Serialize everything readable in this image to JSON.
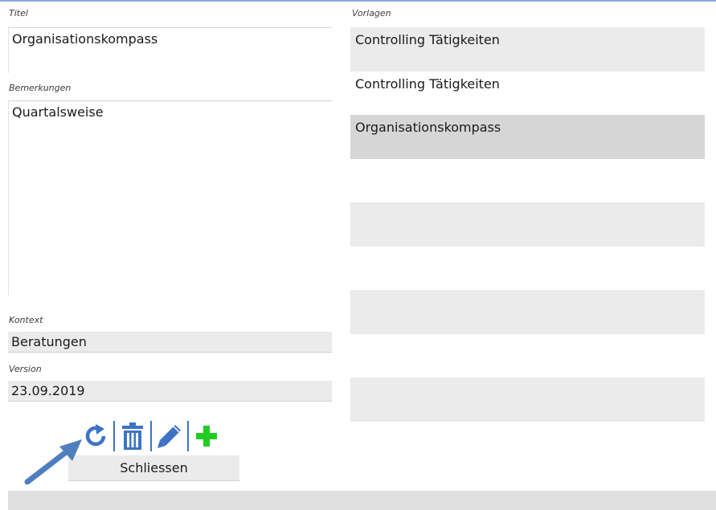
{
  "labels": {
    "titel": "Titel",
    "bemerkungen": "Bemerkungen",
    "kontext": "Kontext",
    "version": "Version",
    "vorlagen": "Vorlagen"
  },
  "fields": {
    "titel": "Organisationskompass",
    "bemerkungen": "Quartalsweise",
    "kontext": "Beratungen",
    "version": "23.09.2019"
  },
  "vorlagen": [
    {
      "label": "Controlling Tätigkeiten",
      "selected": false
    },
    {
      "label": "Controlling Tätigkeiten",
      "selected": false
    },
    {
      "label": "Organisationskompass",
      "selected": true
    },
    {
      "label": "",
      "selected": false
    },
    {
      "label": "",
      "selected": false
    },
    {
      "label": "",
      "selected": false
    },
    {
      "label": "",
      "selected": false
    },
    {
      "label": "",
      "selected": false
    }
  ],
  "toolbar": {
    "refresh_icon": "refresh-icon",
    "delete_icon": "trash-icon",
    "edit_icon": "pencil-icon",
    "add_icon": "plus-icon"
  },
  "close_button": "Schliessen",
  "colors": {
    "accent_blue": "#3d73c6",
    "add_green": "#22cc22",
    "arrow_blue": "#4f7fbf",
    "field_gray": "#ebebeb",
    "selected_gray": "#d6d6d6"
  }
}
